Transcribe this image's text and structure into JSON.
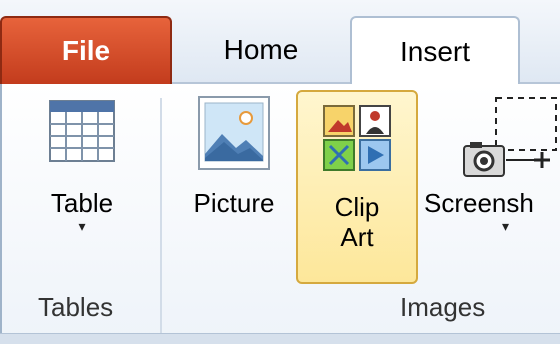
{
  "tabs": {
    "file": "File",
    "home": "Home",
    "insert": "Insert"
  },
  "groups": {
    "tables": {
      "label": "Tables",
      "table_button": "Table"
    },
    "images": {
      "label": "Images",
      "picture_button": "Picture",
      "clipart_line1": "Clip",
      "clipart_line2": "Art",
      "screenshot_button": "Screensh"
    }
  },
  "dropdown_glyph": "▾",
  "icons": {
    "table": "table-grid-icon",
    "picture": "picture-icon",
    "clipart": "clip-art-icon",
    "screenshot": "screenshot-camera-icon"
  },
  "colors": {
    "file_tab": "#d04a27",
    "clipart_highlight": "#fde79a",
    "ribbon_border": "#b7c6d8"
  }
}
